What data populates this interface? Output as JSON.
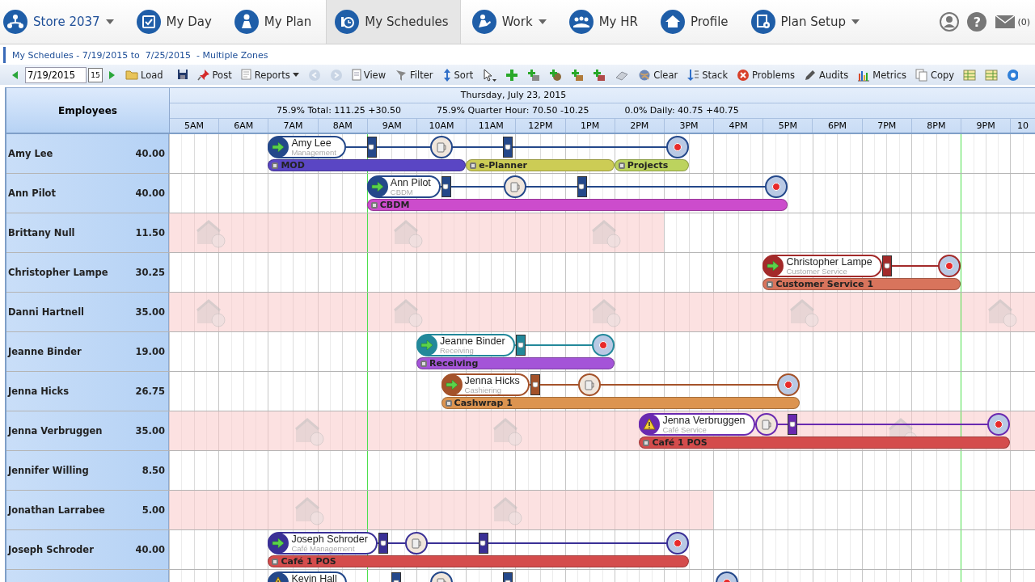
{
  "nav": {
    "items": [
      {
        "label": "Store 2037",
        "dropdown": true,
        "selected": false
      },
      {
        "label": "My Day",
        "dropdown": false,
        "selected": false
      },
      {
        "label": "My Plan",
        "dropdown": false,
        "selected": false
      },
      {
        "label": "My Schedules",
        "dropdown": false,
        "selected": true
      },
      {
        "label": "Work",
        "dropdown": true,
        "selected": false
      },
      {
        "label": "My HR",
        "dropdown": false,
        "selected": false
      },
      {
        "label": "Profile",
        "dropdown": false,
        "selected": false
      },
      {
        "label": "Plan Setup",
        "dropdown": true,
        "selected": false
      }
    ],
    "help": "?",
    "mail_count": "(0)"
  },
  "breadcrumb": "My Schedules - 7/19/2015 to  7/25/2015  - Multiple Zones",
  "toolbar": [
    {
      "kind": "button",
      "disabled": false
    },
    {
      "kind": "date",
      "value": "7/19/2015"
    },
    {
      "kind": "calendar",
      "label": "15"
    },
    {
      "kind": "button",
      "disabled": false
    },
    {
      "kind": "button",
      "label": "Load",
      "disabled": false
    },
    {
      "kind": "sep"
    },
    {
      "kind": "button",
      "disabled": false
    },
    {
      "kind": "button",
      "label": "Post",
      "disabled": false
    },
    {
      "kind": "button",
      "label": "Reports",
      "dropdown": true,
      "disabled": false
    },
    {
      "kind": "button",
      "disabled": true
    },
    {
      "kind": "button",
      "disabled": true
    },
    {
      "kind": "button",
      "label": "View",
      "disabled": false
    },
    {
      "kind": "button",
      "label": "Filter",
      "disabled": false
    },
    {
      "kind": "button",
      "label": "Sort",
      "disabled": false
    },
    {
      "kind": "button",
      "disabled": false
    },
    {
      "kind": "button",
      "disabled": false
    },
    {
      "kind": "button",
      "disabled": false
    },
    {
      "kind": "button",
      "disabled": false
    },
    {
      "kind": "button",
      "disabled": false
    },
    {
      "kind": "button",
      "disabled": false
    },
    {
      "kind": "button",
      "disabled": false
    },
    {
      "kind": "button",
      "label": "Clear",
      "disabled": false
    },
    {
      "kind": "button",
      "label": "Stack",
      "disabled": false
    },
    {
      "kind": "button",
      "label": "Problems",
      "disabled": false
    },
    {
      "kind": "button",
      "label": "Audits",
      "disabled": false
    },
    {
      "kind": "button",
      "label": "Metrics",
      "disabled": false
    },
    {
      "kind": "button",
      "label": "Copy",
      "disabled": false
    },
    {
      "kind": "button",
      "disabled": false
    },
    {
      "kind": "button",
      "disabled": false
    },
    {
      "kind": "button",
      "disabled": false
    }
  ],
  "grid": {
    "employees_header": "Employees",
    "date": "Thursday, July 23, 2015",
    "stats": [
      "75.9% Total: 111.25 +30.50",
      "75.9% Quarter Hour: 70.50 -10.25",
      "0.0% Daily: 40.75 +40.75"
    ],
    "hours": [
      "5AM",
      "6AM",
      "7AM",
      "8AM",
      "9AM",
      "10AM",
      "11AM",
      "12PM",
      "1PM",
      "2PM",
      "3PM",
      "4PM",
      "5PM",
      "6PM",
      "7PM",
      "8PM",
      "9PM",
      "10"
    ],
    "rows": [
      {
        "employee": "Amy Lee",
        "hours": "40.00",
        "unavailable": false,
        "shift": {
          "name": "Amy Lee",
          "role": "Management",
          "kind": "arrow",
          "color": "#24488a",
          "breaks": [
            {
              "kind": "break"
            },
            {
              "kind": "meal"
            },
            {
              "kind": "break"
            }
          ],
          "tasks": [
            {
              "label": "MOD",
              "color": "#5a46c4"
            },
            {
              "label": "e-Planner",
              "color": "#cccc55"
            },
            {
              "label": "Projects",
              "color": "#bcd35e"
            }
          ]
        }
      },
      {
        "employee": "Ann Pilot",
        "hours": "40.00",
        "unavailable": false,
        "shift": {
          "name": "Ann Pilot",
          "role": "CBDM",
          "kind": "arrow",
          "color": "#24488a",
          "breaks": [
            {
              "kind": "break"
            },
            {
              "kind": "meal"
            },
            {
              "kind": "break"
            }
          ],
          "tasks": [
            {
              "label": "CBDM",
              "color": "#cc4ccc"
            }
          ]
        }
      },
      {
        "employee": "Brittany Null",
        "hours": "11.50",
        "unavailable": true
      },
      {
        "employee": "Christopher Lampe",
        "hours": "30.25",
        "unavailable": false,
        "shift": {
          "name": "Christopher Lampe",
          "role": "Customer Service",
          "kind": "arrow",
          "color": "#a32a2a",
          "breaks": [
            {
              "kind": "break"
            }
          ],
          "tasks": [
            {
              "label": "Customer Service 1",
              "color": "#d8745c"
            }
          ]
        }
      },
      {
        "employee": "Danni Hartnell",
        "hours": "35.00",
        "unavailable": true
      },
      {
        "employee": "Jeanne Binder",
        "hours": "19.00",
        "unavailable": false,
        "shift": {
          "name": "Jeanne Binder",
          "role": "Receiving",
          "kind": "arrow",
          "color": "#23889a",
          "breaks": [
            {
              "kind": "break"
            }
          ],
          "tasks": [
            {
              "label": "Receiving",
              "color": "#a454d8"
            }
          ]
        }
      },
      {
        "employee": "Jenna Hicks",
        "hours": "26.75",
        "unavailable": false,
        "shift": {
          "name": "Jenna Hicks",
          "role": "Cashiering",
          "kind": "arrow",
          "color": "#a4522a",
          "breaks": [
            {
              "kind": "break"
            },
            {
              "kind": "meal"
            }
          ],
          "tasks": [
            {
              "label": "Cashwrap 1",
              "color": "#dc9450"
            }
          ]
        }
      },
      {
        "employee": "Jenna Verbruggen",
        "hours": "35.00",
        "unavailable": true,
        "shift": {
          "name": "Jenna Verbruggen",
          "role": "Café Service",
          "kind": "warning",
          "color": "#6a2ab0",
          "breaks": [
            {
              "kind": "meal"
            },
            {
              "kind": "break"
            }
          ],
          "tasks": [
            {
              "label": "Café 1 POS",
              "color": "#d44c4c"
            }
          ]
        }
      },
      {
        "employee": "Jennifer Willing",
        "hours": "8.50",
        "unavailable": false
      },
      {
        "employee": "Jonathan Larrabee",
        "hours": "5.00",
        "unavailable": true
      },
      {
        "employee": "Joseph Schroder",
        "hours": "40.00",
        "unavailable": false,
        "shift": {
          "name": "Joseph Schroder",
          "role": "Café Management",
          "kind": "arrow",
          "color": "#3a3096",
          "breaks": [
            {
              "kind": "break"
            },
            {
              "kind": "meal"
            },
            {
              "kind": "break"
            }
          ],
          "tasks": [
            {
              "label": "Café 1 POS",
              "color": "#d44c4c"
            }
          ]
        }
      },
      {
        "unavailable": false,
        "shift": {
          "name": "Kevin Hall",
          "kind": "warning",
          "color": "#24488a",
          "breaks": [
            {
              "kind": "break"
            },
            {
              "kind": "meal"
            },
            {
              "kind": "break"
            }
          ]
        }
      }
    ]
  }
}
